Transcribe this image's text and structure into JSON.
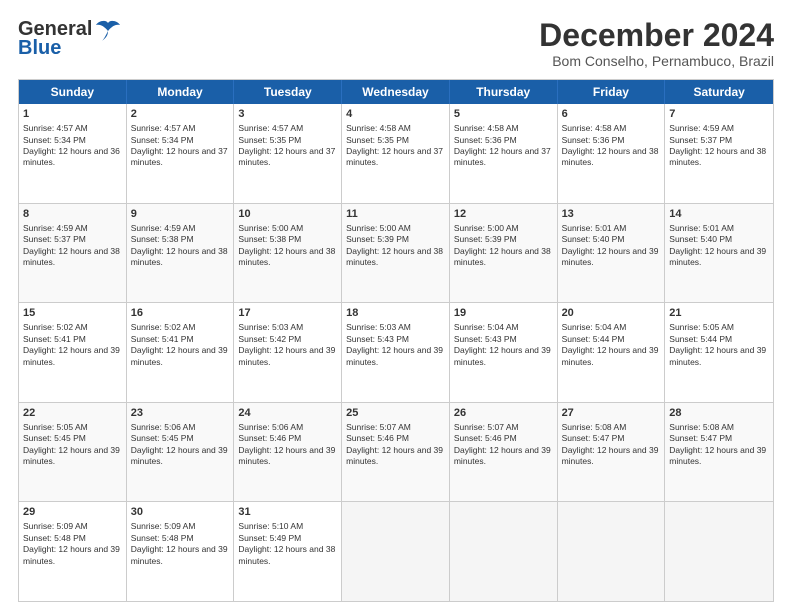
{
  "header": {
    "logo_line1": "General",
    "logo_line2": "Blue",
    "month": "December 2024",
    "location": "Bom Conselho, Pernambuco, Brazil"
  },
  "days": [
    "Sunday",
    "Monday",
    "Tuesday",
    "Wednesday",
    "Thursday",
    "Friday",
    "Saturday"
  ],
  "weeks": [
    [
      {
        "day": "1",
        "rise": "4:57 AM",
        "set": "5:34 PM",
        "dl": "12 hours and 36 minutes."
      },
      {
        "day": "2",
        "rise": "4:57 AM",
        "set": "5:34 PM",
        "dl": "12 hours and 37 minutes."
      },
      {
        "day": "3",
        "rise": "4:57 AM",
        "set": "5:35 PM",
        "dl": "12 hours and 37 minutes."
      },
      {
        "day": "4",
        "rise": "4:58 AM",
        "set": "5:35 PM",
        "dl": "12 hours and 37 minutes."
      },
      {
        "day": "5",
        "rise": "4:58 AM",
        "set": "5:36 PM",
        "dl": "12 hours and 37 minutes."
      },
      {
        "day": "6",
        "rise": "4:58 AM",
        "set": "5:36 PM",
        "dl": "12 hours and 38 minutes."
      },
      {
        "day": "7",
        "rise": "4:59 AM",
        "set": "5:37 PM",
        "dl": "12 hours and 38 minutes."
      }
    ],
    [
      {
        "day": "8",
        "rise": "4:59 AM",
        "set": "5:37 PM",
        "dl": "12 hours and 38 minutes."
      },
      {
        "day": "9",
        "rise": "4:59 AM",
        "set": "5:38 PM",
        "dl": "12 hours and 38 minutes."
      },
      {
        "day": "10",
        "rise": "5:00 AM",
        "set": "5:38 PM",
        "dl": "12 hours and 38 minutes."
      },
      {
        "day": "11",
        "rise": "5:00 AM",
        "set": "5:39 PM",
        "dl": "12 hours and 38 minutes."
      },
      {
        "day": "12",
        "rise": "5:00 AM",
        "set": "5:39 PM",
        "dl": "12 hours and 38 minutes."
      },
      {
        "day": "13",
        "rise": "5:01 AM",
        "set": "5:40 PM",
        "dl": "12 hours and 39 minutes."
      },
      {
        "day": "14",
        "rise": "5:01 AM",
        "set": "5:40 PM",
        "dl": "12 hours and 39 minutes."
      }
    ],
    [
      {
        "day": "15",
        "rise": "5:02 AM",
        "set": "5:41 PM",
        "dl": "12 hours and 39 minutes."
      },
      {
        "day": "16",
        "rise": "5:02 AM",
        "set": "5:41 PM",
        "dl": "12 hours and 39 minutes."
      },
      {
        "day": "17",
        "rise": "5:03 AM",
        "set": "5:42 PM",
        "dl": "12 hours and 39 minutes."
      },
      {
        "day": "18",
        "rise": "5:03 AM",
        "set": "5:43 PM",
        "dl": "12 hours and 39 minutes."
      },
      {
        "day": "19",
        "rise": "5:04 AM",
        "set": "5:43 PM",
        "dl": "12 hours and 39 minutes."
      },
      {
        "day": "20",
        "rise": "5:04 AM",
        "set": "5:44 PM",
        "dl": "12 hours and 39 minutes."
      },
      {
        "day": "21",
        "rise": "5:05 AM",
        "set": "5:44 PM",
        "dl": "12 hours and 39 minutes."
      }
    ],
    [
      {
        "day": "22",
        "rise": "5:05 AM",
        "set": "5:45 PM",
        "dl": "12 hours and 39 minutes."
      },
      {
        "day": "23",
        "rise": "5:06 AM",
        "set": "5:45 PM",
        "dl": "12 hours and 39 minutes."
      },
      {
        "day": "24",
        "rise": "5:06 AM",
        "set": "5:46 PM",
        "dl": "12 hours and 39 minutes."
      },
      {
        "day": "25",
        "rise": "5:07 AM",
        "set": "5:46 PM",
        "dl": "12 hours and 39 minutes."
      },
      {
        "day": "26",
        "rise": "5:07 AM",
        "set": "5:46 PM",
        "dl": "12 hours and 39 minutes."
      },
      {
        "day": "27",
        "rise": "5:08 AM",
        "set": "5:47 PM",
        "dl": "12 hours and 39 minutes."
      },
      {
        "day": "28",
        "rise": "5:08 AM",
        "set": "5:47 PM",
        "dl": "12 hours and 39 minutes."
      }
    ],
    [
      {
        "day": "29",
        "rise": "5:09 AM",
        "set": "5:48 PM",
        "dl": "12 hours and 39 minutes."
      },
      {
        "day": "30",
        "rise": "5:09 AM",
        "set": "5:48 PM",
        "dl": "12 hours and 39 minutes."
      },
      {
        "day": "31",
        "rise": "5:10 AM",
        "set": "5:49 PM",
        "dl": "12 hours and 38 minutes."
      },
      null,
      null,
      null,
      null
    ]
  ]
}
